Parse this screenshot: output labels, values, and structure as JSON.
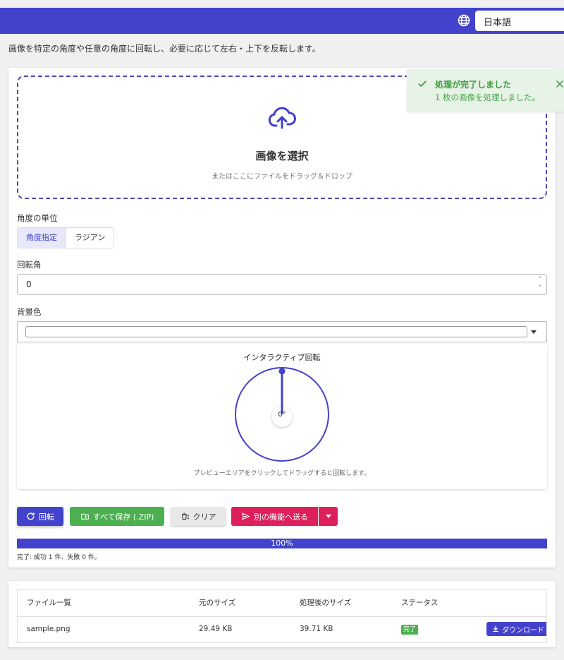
{
  "header": {
    "language": "日本語"
  },
  "description": "画像を特定の角度や任意の角度に回転し、必要に応じて左右・上下を反転します。",
  "dropzone": {
    "title": "画像を選択",
    "subtitle": "またはここにファイルをドラッグ＆ドロップ"
  },
  "angle_unit": {
    "label": "角度の単位",
    "options": [
      "角度指定",
      "ラジアン"
    ],
    "selected": "角度指定"
  },
  "rotation": {
    "label": "回転角",
    "value": "0"
  },
  "background": {
    "label": "背景色",
    "color": "#ffffff"
  },
  "interactive": {
    "title": "インタラクティブ回転",
    "angle_display": "0°",
    "angle_deg": 0,
    "hint": "プレビューエリアをクリックしてドラッグすると回転します。"
  },
  "actions": {
    "rotate": "回転",
    "save_zip": "すべて保存 (.ZIP)",
    "clear": "クリア",
    "send": "別の機能へ送る"
  },
  "progress": {
    "percent": 100,
    "text": "100%",
    "result": "完了: 成功 1 件、失敗 0 件。"
  },
  "files": {
    "headers": [
      "ファイル一覧",
      "元のサイズ",
      "処理後のサイズ",
      "ステータス"
    ],
    "rows": [
      {
        "name": "sample.png",
        "original_size": "29.49 KB",
        "processed_size": "39.71 KB",
        "status": "完了",
        "download": "ダウンロード"
      }
    ]
  },
  "toast": {
    "title": "処理が完了しました",
    "message": "1 枚の画像を処理しました。"
  },
  "colors": {
    "primary": "#4242cc",
    "success": "#4caf50",
    "accent": "#dd1f5c"
  }
}
